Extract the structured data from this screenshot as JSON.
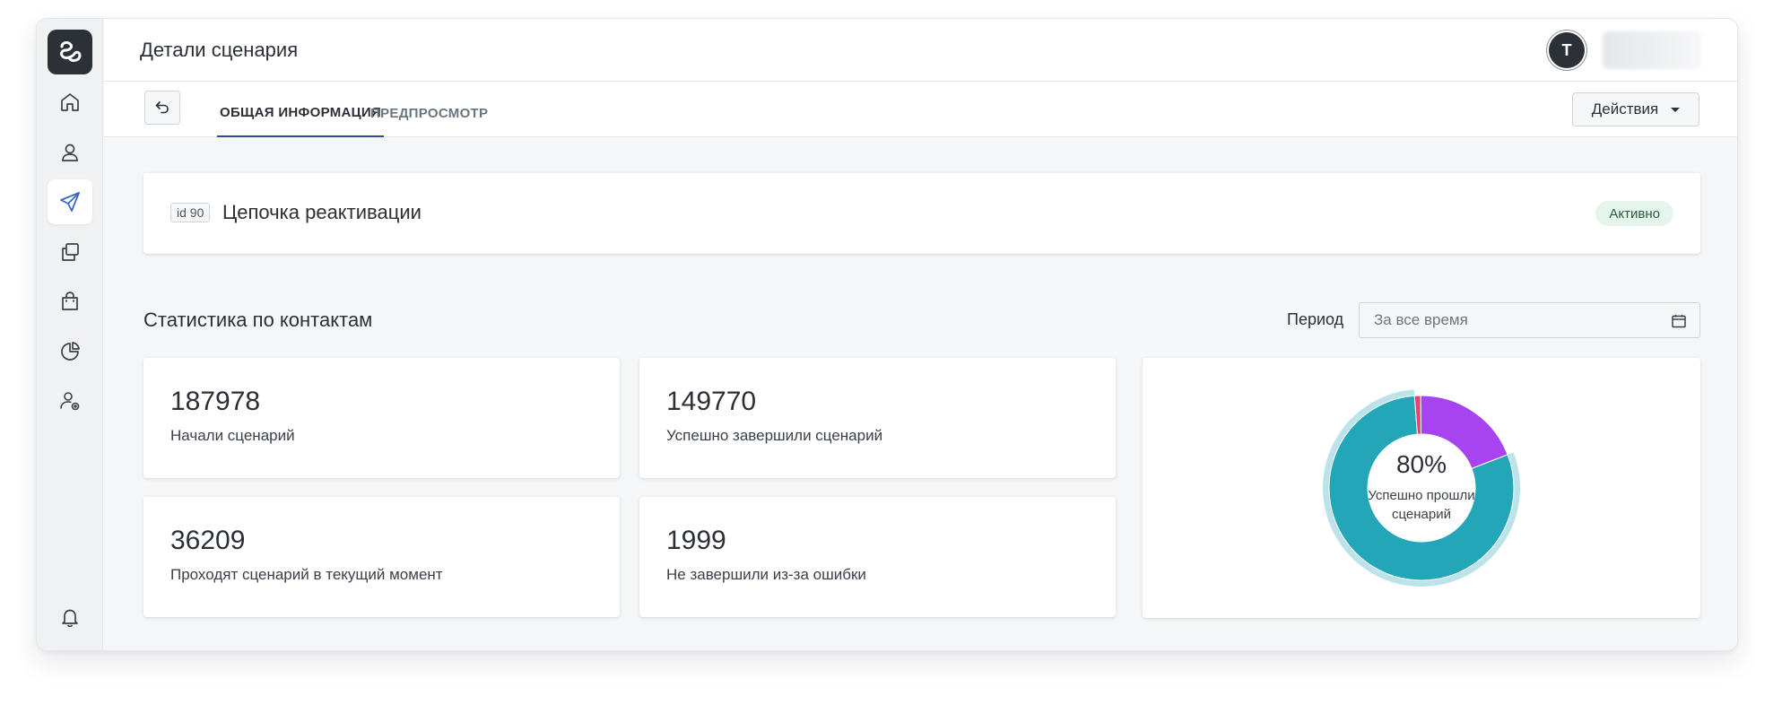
{
  "header": {
    "title": "Детали сценария",
    "avatar_initial": "T"
  },
  "tabs": [
    {
      "label": "ОБЩАЯ ИНФОРМАЦИЯ",
      "active": true
    },
    {
      "label": "ПРЕДПРОСМОТР",
      "active": false
    }
  ],
  "actions_label": "Действия",
  "sidebar": {
    "items": [
      {
        "icon": "home-icon"
      },
      {
        "icon": "user-icon"
      },
      {
        "icon": "send-icon",
        "active": true
      },
      {
        "icon": "copy-icon"
      },
      {
        "icon": "bag-icon"
      },
      {
        "icon": "pie-chart-icon"
      },
      {
        "icon": "user-settings-icon"
      },
      {
        "icon": "bell-icon"
      }
    ]
  },
  "scenario": {
    "id_label": "id 90",
    "name": "Цепочка реактивации",
    "status": "Активно"
  },
  "stats": {
    "title": "Статистика по контактам",
    "period_label": "Период",
    "period_placeholder": "За все время",
    "cards": [
      {
        "value": "187978",
        "label": "Начали сценарий"
      },
      {
        "value": "149770",
        "label": "Успешно завершили сценарий"
      },
      {
        "value": "36209",
        "label": "Проходят сценарий в текущий момент"
      },
      {
        "value": "1999",
        "label": "Не завершили из-за ошибки"
      }
    ]
  },
  "chart_data": {
    "type": "pie",
    "donut": true,
    "center_value": "80%",
    "center_label_line1": "Успешно прошли",
    "center_label_line2": "сценарий",
    "slices": [
      {
        "value": 149770,
        "color": "#22a6b8"
      },
      {
        "value": 36209,
        "color": "#a744f0"
      },
      {
        "value": 1999,
        "color": "#e8436e"
      }
    ],
    "highlight_slice": 0,
    "highlight_color": "#bde3ea"
  },
  "colors": {
    "accent": "#2a4d9c",
    "active_icon": "#3a66c4",
    "icon": "#3a4049"
  }
}
